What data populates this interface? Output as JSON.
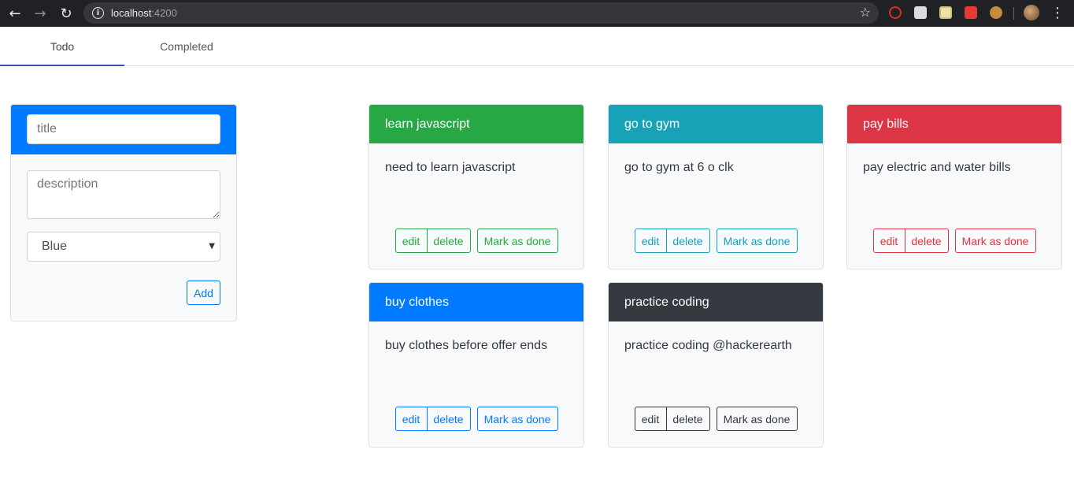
{
  "browser": {
    "url_host": "localhost",
    "url_port": ":4200",
    "back_icon": "←",
    "forward_icon": "→",
    "reload_icon": "↻",
    "star_icon": "☆",
    "menu_icon": "⋮"
  },
  "tabs": [
    {
      "label": "Todo",
      "active": true
    },
    {
      "label": "Completed",
      "active": false
    }
  ],
  "form": {
    "title_placeholder": "title",
    "description_placeholder": "description",
    "color_selected": "Blue",
    "add_label": "Add",
    "accent": "#007bff"
  },
  "todos": [
    {
      "title": "learn javascript",
      "description": "need to learn javascript",
      "color": "#28a745"
    },
    {
      "title": "go to gym",
      "description": "go to gym at 6 o clk",
      "color": "#17a2b8"
    },
    {
      "title": "pay bills",
      "description": "pay electric and water bills",
      "color": "#dc3545"
    },
    {
      "title": "buy clothes",
      "description": "buy clothes before offer ends",
      "color": "#007bff"
    },
    {
      "title": "practice coding",
      "description": "practice coding @hackerearth",
      "color": "#343a40"
    }
  ],
  "buttons": {
    "edit": "edit",
    "delete": "delete",
    "done": "Mark as done"
  }
}
